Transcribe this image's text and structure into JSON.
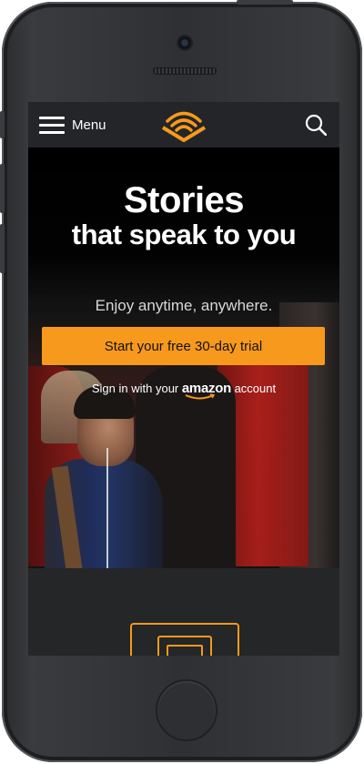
{
  "header": {
    "menu_label": "Menu",
    "logo_icon": "audible-logo-icon",
    "search_icon": "search-icon"
  },
  "hero": {
    "headline_line1": "Stories",
    "headline_line2": "that speak to you",
    "tagline": "Enjoy anytime, anywhere.",
    "cta_label": "Start your free 30-day trial",
    "signin_prefix": "Sign in with your",
    "signin_brand": "amazon",
    "signin_suffix": "account"
  },
  "colors": {
    "accent": "#f7991c",
    "header_bg": "#232528",
    "text_light": "#ffffff"
  }
}
